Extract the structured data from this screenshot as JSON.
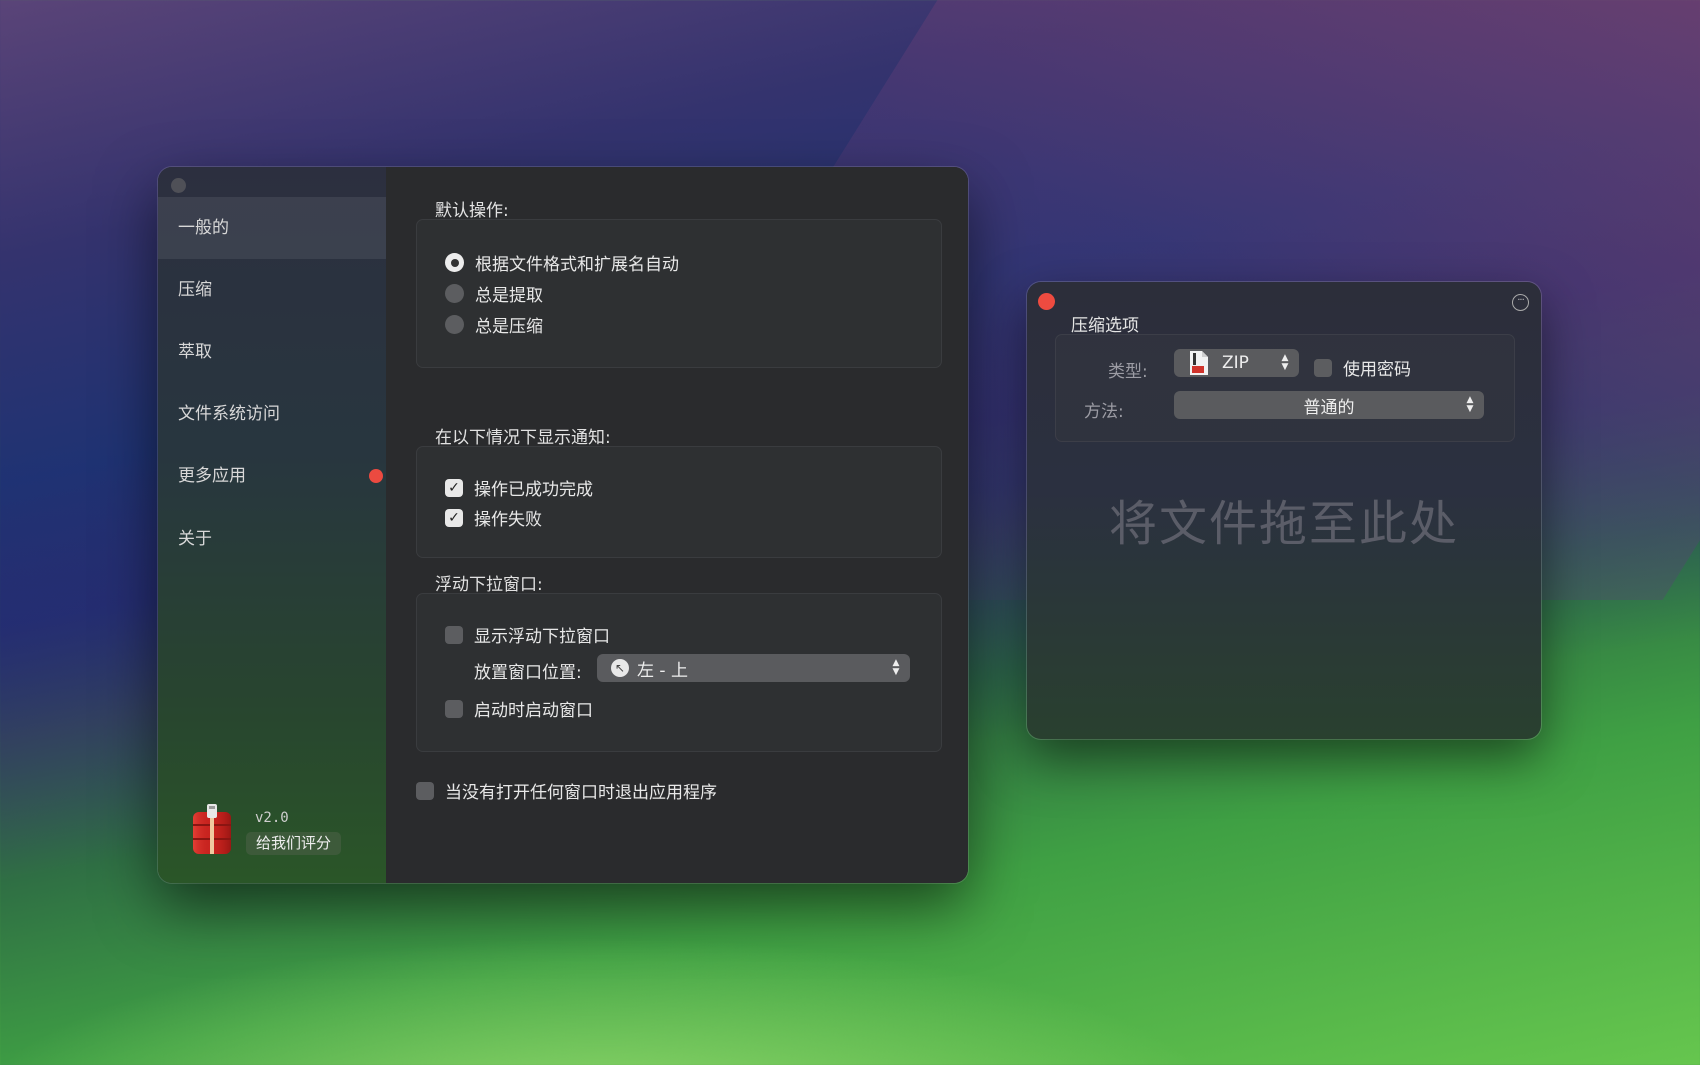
{
  "main": {
    "sidebar": {
      "items": [
        {
          "label": "一般的"
        },
        {
          "label": "压缩"
        },
        {
          "label": "萃取"
        },
        {
          "label": "文件系统访问"
        },
        {
          "label": "更多应用"
        },
        {
          "label": "关于"
        }
      ],
      "version": "v2.0",
      "rate_label": "给我们评分"
    },
    "default_action": {
      "title": "默认操作:",
      "options": [
        "根据文件格式和扩展名自动",
        "总是提取",
        "总是压缩"
      ],
      "selected": "根据文件格式和扩展名自动"
    },
    "notifications": {
      "title": "在以下情况下显示通知:",
      "options": [
        {
          "label": "操作已成功完成",
          "checked": true
        },
        {
          "label": "操作失败",
          "checked": true
        }
      ]
    },
    "floating": {
      "title": "浮动下拉窗口:",
      "show_label": "显示浮动下拉窗口",
      "show_checked": false,
      "position_label": "放置窗口位置:",
      "position_value": "左 - 上",
      "launch_label": "启动时启动窗口",
      "launch_checked": false
    },
    "quit_label": "当没有打开任何窗口时退出应用程序",
    "quit_checked": false
  },
  "compress": {
    "title": "压缩选项",
    "type_label": "类型:",
    "type_value": "ZIP",
    "password_label": "使用密码",
    "password_checked": false,
    "method_label": "方法:",
    "method_value": "普通的",
    "drop_text": "将文件拖至此处"
  },
  "colors": {
    "accent_red": "#ec4a40",
    "window_bg": "#2b2c2e"
  }
}
